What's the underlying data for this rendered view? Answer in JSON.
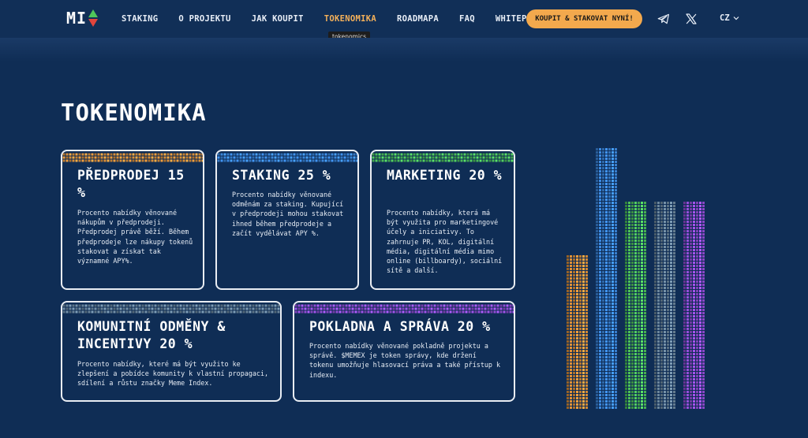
{
  "nav": {
    "logo_text": "MI",
    "links": [
      {
        "label": "STAKING"
      },
      {
        "label": "O PROJEKTU"
      },
      {
        "label": "JAK KOUPIT"
      },
      {
        "label": "TOKENOMIKA",
        "active": true
      },
      {
        "label": "ROADMAPA"
      },
      {
        "label": "FAQ"
      },
      {
        "label": "WHITEPAPER"
      }
    ],
    "cta_label": "KOUPIT & STAKOVAT NYNÍ!",
    "lang_label": "CZ",
    "tooltip": "tokenomics"
  },
  "section": {
    "title": "TOKENOMIKA"
  },
  "cards": [
    {
      "title": "PŘEDPRODEJ 15 %",
      "body": "Procento nabídky věnované nákupům v předprodeji. Předprodej právě běží. Během předprodeje lze nákupy tokenů stakovat a získat tak významné APY%.",
      "color": "#e8973a"
    },
    {
      "title": "STAKING 25 %",
      "body": "Procento nabídky věnované odměnám za staking. Kupující v předprodeji mohou stakovat ihned během předprodeje a začít vydělávat APY %.",
      "color": "#3f8ee8"
    },
    {
      "title": "MARKETING 20 %",
      "body": "Procento nabídky, která má být využita pro marketingové účely a iniciativy. To zahrnuje PR, KOL, digitální média, digitální média mimo online (billboardy), sociální sítě a další.",
      "color": "#4fc65a"
    },
    {
      "title": "KOMUNITNÍ ODMĚNY & INCENTIVY 20 %",
      "body": "Procento nabídky, které má být využito ke zlepšení a pobídce komunity k vlastní propagaci, sdílení a růstu značky Meme Index.",
      "color": "#6f8aa0"
    },
    {
      "title": "POKLADNA A SPRÁVA 20 %",
      "body": "Procento nabídky věnované pokladně projektu a správě. $MEMEX je token správy, kde držení tokenu umožňuje hlasovací práva a také přístup k indexu.",
      "color": "#9b4fe0"
    }
  ],
  "chart_data": {
    "type": "bar",
    "categories": [
      "PŘEDPRODEJ",
      "STAKING",
      "MARKETING",
      "KOMUNITNÍ ODMĚNY & INCENTIVY",
      "POKLADNA A SPRÁVA"
    ],
    "values": [
      15,
      25,
      20,
      20,
      20
    ],
    "colors": [
      "#e8973a",
      "#3f8ee8",
      "#4fc65a",
      "#6f8aa0",
      "#9b4fe0"
    ],
    "ylim": [
      0,
      25
    ]
  },
  "icons": {
    "telegram": "telegram-icon",
    "x": "x-twitter-icon",
    "chevron": "chevron-down-icon"
  }
}
